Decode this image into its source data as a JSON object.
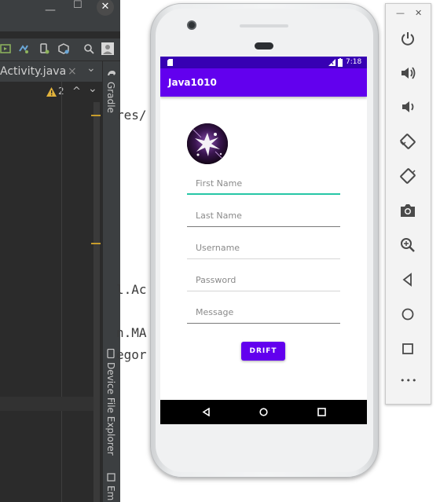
{
  "ide": {
    "tab_title": "Activity.java",
    "tab_close": "×",
    "tab_menu": "⌄",
    "warning_count": "2",
    "up_glyph": "^",
    "down_glyph": "⌄",
    "gradle_label": "Gradle",
    "device_explorer_label": "Device File Explorer",
    "emulator_label": "Em",
    "window_controls": {
      "minimize": "—",
      "maximize": "☐",
      "close": "✕"
    }
  },
  "editor": {
    "code_lines": [
      "res/",
      "l.Ac",
      "n.MA",
      "egor"
    ]
  },
  "emulator": {
    "status_time": "7:18",
    "app_title": "Java1010",
    "fields": [
      {
        "placeholder": "First Name",
        "focused": true
      },
      {
        "placeholder": "Last Name",
        "focused": false
      },
      {
        "placeholder": "Username",
        "focused": false
      },
      {
        "placeholder": "Password",
        "focused": false
      },
      {
        "placeholder": "Message",
        "focused": false
      }
    ],
    "button_label": "DRIFT",
    "accent_color": "#6200ee",
    "status_bar_color": "#3700b3",
    "focus_color": "#26c6a6"
  },
  "emulator_panel": {
    "minimize": "—",
    "close": "✕",
    "more": "•••",
    "controls": [
      "power-icon",
      "volume-up-icon",
      "volume-down-icon",
      "rotate-left-icon",
      "rotate-right-icon",
      "camera-icon",
      "zoom-icon",
      "back-icon",
      "home-icon",
      "overview-icon",
      "more-icon"
    ]
  }
}
